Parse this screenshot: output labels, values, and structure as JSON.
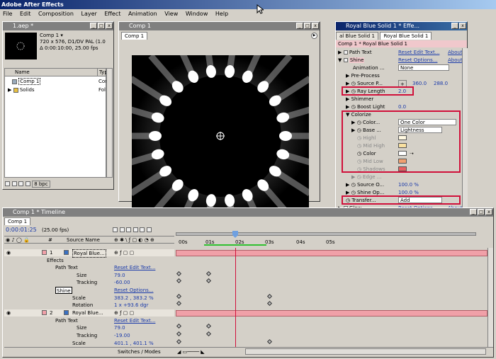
{
  "app": {
    "title": "Adobe After Effects"
  },
  "menu": [
    "File",
    "Edit",
    "Composition",
    "Layer",
    "Effect",
    "Animation",
    "View",
    "Window",
    "Help"
  ],
  "project": {
    "title": "1.aep *",
    "comp_name": "Comp 1 ▾",
    "comp_info1": "720 x 576, D1/DV PAL (1.0",
    "comp_info2": "Δ 0:00:10:00, 25.00 fps",
    "col_name": "Name",
    "col_type": "Type",
    "items": [
      {
        "name": "Comp 1",
        "type": "Com"
      },
      {
        "name": "Solids",
        "type": "Fol"
      }
    ],
    "bpc": "8 bpc"
  },
  "comp": {
    "title": "Comp 1",
    "tab": "Comp 1"
  },
  "effects": {
    "title": "Royal Blue Solid 1 * Effe...",
    "tab1": "al Blue Solid 1",
    "tab2": "Royal Blue Solid 1",
    "breadcrumb": "Comp 1 * Royal Blue Solid 1",
    "rows": {
      "path_text": "Path Text",
      "path_reset": "Reset Edit Text...",
      "path_about": "About",
      "shine": "Shine",
      "shine_reset": "Reset Options...",
      "shine_about": "About",
      "animation": "Animation ...",
      "animation_val": "None",
      "preprocess": "Pre-Process",
      "source_p": "Source P...",
      "source_x": "360.0",
      "source_y": "288.0",
      "ray_length": "Ray Length",
      "ray_val": "2.0",
      "shimmer": "Shimmer",
      "boost_light": "Boost Light",
      "boost_val": "0.0",
      "colorize": "Colorize",
      "color_label": "Color...",
      "color_val": "One Color",
      "base_label": "Base ...",
      "base_val": "Lightness",
      "highl": "Highl",
      "midhigh": "Mid High",
      "color2": "Color",
      "midlow": "Mid Low",
      "shadows": "Shadows",
      "edge": "Edge ...",
      "source_o": "Source O...",
      "source_o_val": "100.0 %",
      "shine_op": "Shine Op...",
      "shine_op_val": "100.0 %",
      "transfer": "Transfer...",
      "transfer_val": "Add",
      "glow": "Glow",
      "glow_reset": "Reset Options...",
      "glow_about": "About"
    }
  },
  "timeline": {
    "title": "Comp 1 * Timeline",
    "tab": "Comp 1",
    "time": "0:00:01:25",
    "fps": "(25.00 fps)",
    "col_num": "#",
    "col_source": "Source Name",
    "ruler": [
      "00s",
      "01s",
      "02s",
      "03s",
      "04s",
      "05s"
    ],
    "switches": "Switches / Modes",
    "layers": [
      {
        "num": "1",
        "name": "Royal Blue..."
      },
      {
        "num": "2",
        "name": "Royal Blue..."
      }
    ],
    "rows": {
      "effects": "Effects",
      "path_text": "Path Text",
      "path_reset": "Reset Edit Text...",
      "size": "Size",
      "size1": "79.0",
      "tracking": "Tracking",
      "tracking1": "-60.00",
      "shine": "Shine",
      "shine_reset": "Reset Options...",
      "scale": "Scale",
      "scale1": "383.2 , 383.2 %",
      "rotation": "Rotation",
      "rotation1": "1 x +93.6 dgr",
      "path_text2": "Path Text",
      "path_reset2": "Reset Edit Text...",
      "size2": "79.0",
      "tracking2": "-19.00",
      "scale2": "401.1 , 401.1 %"
    }
  },
  "colors": {
    "accent": "#0a246a",
    "highlight": "#d0103a",
    "layerbar": "#f0a0a8"
  }
}
